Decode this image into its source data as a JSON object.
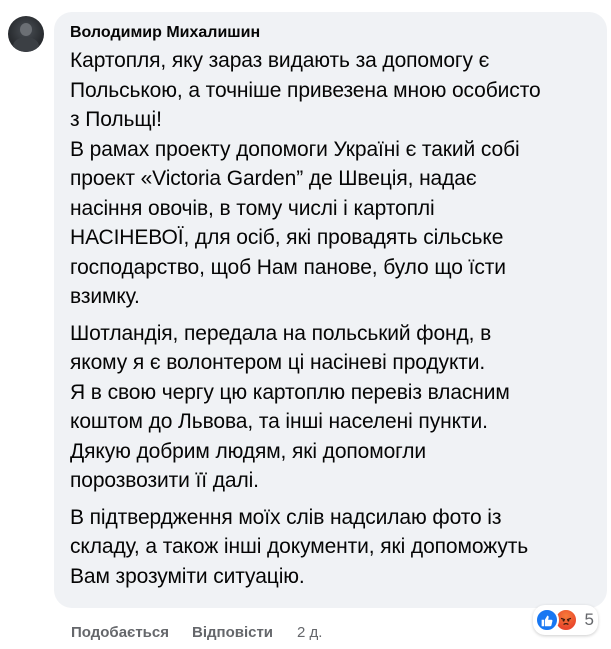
{
  "comment": {
    "author": "Володимир Михалишин",
    "paragraphs": [
      {
        "lines": [
          "Картопля, яку зараз видають за допомогу є",
          "Польською, а точніше привезена мною особисто",
          "з Польщі!",
          "В рамах проекту допомоги Україні є такий собі",
          "проект «Victoria Garden” де Швеція, надає",
          "насіння овочів, в тому числі і картоплі",
          "НАСІНЕВОЇ, для осіб, які провадять сільське",
          "господарство, щоб Нам панове, було що їсти",
          "взимку."
        ]
      },
      {
        "lines": [
          "Шотландія, передала на польський фонд, в",
          "якому я є волонтером ці насіневі продукти.",
          "Я в свою чергу цю картоплю перевіз власним",
          "коштом до Львова, та інші населені пункти.",
          "Дякую добрим людям, які допомогли",
          "порозвозити її далі."
        ]
      },
      {
        "lines": [
          "В підтвердження моїх слів надсилаю фото із",
          "складу, а також інші документи, які допоможуть",
          "Вам зрозуміти ситуацію."
        ]
      }
    ],
    "reactions": {
      "icons": [
        "like-icon",
        "angry-icon"
      ],
      "count": "5"
    },
    "actions": {
      "like_label": "Подобається",
      "reply_label": "Відповісти",
      "timestamp": "2 д."
    }
  },
  "colors": {
    "bubble": "#f0f2f5",
    "text": "#050505",
    "secondary": "#65676b",
    "like_blue": "#1877f2",
    "angry_orange": "#e9472c"
  }
}
